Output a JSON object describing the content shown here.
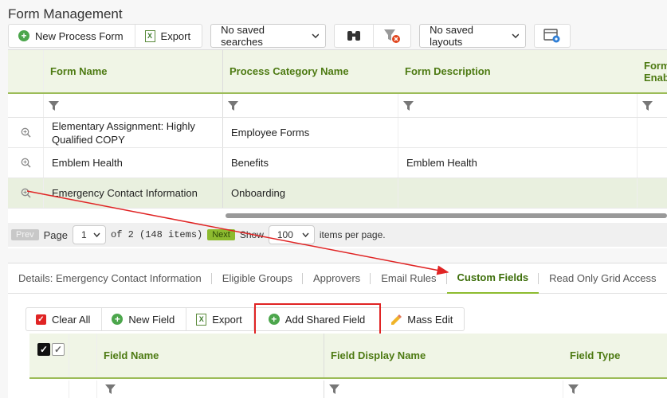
{
  "page": {
    "title": "Form Management"
  },
  "toolbar": {
    "new_process_form": "New Process Form",
    "export": "Export",
    "saved_searches": "No saved searches",
    "saved_layouts": "No saved layouts"
  },
  "grid": {
    "columns": [
      "Form Name",
      "Process Category Name",
      "Form Description",
      "Form",
      "Enab"
    ],
    "rows": [
      {
        "form_name": "Elementary Assignment: Highly Qualified COPY",
        "category": "Employee Forms",
        "description": ""
      },
      {
        "form_name": "Emblem Health",
        "category": "Benefits",
        "description": "Emblem Health"
      },
      {
        "form_name": "Emergency Contact Information",
        "category": "Onboarding",
        "description": ""
      }
    ]
  },
  "pager": {
    "prev": "Prev",
    "page_label": "Page",
    "page_value": "1",
    "of_text": "of 2 (148 items)",
    "next": "Next",
    "show_label": "Show",
    "per_page_value": "100",
    "per_page_suffix": "items per page."
  },
  "detail": {
    "tabs": [
      "Details: Emergency Contact Information",
      "Eligible Groups",
      "Approvers",
      "Email Rules",
      "Custom Fields",
      "Read Only Grid Access"
    ],
    "active_tab": "Custom Fields",
    "toolbar": {
      "clear_all": "Clear All",
      "new_field": "New Field",
      "export": "Export",
      "add_shared_field": "Add Shared Field",
      "mass_edit": "Mass Edit"
    },
    "columns": [
      "Field Name",
      "Field Display Name",
      "Field Type"
    ]
  },
  "colors": {
    "accent": "#8dbb2f",
    "header_text": "#4d7a12",
    "highlight": "#e02424"
  }
}
